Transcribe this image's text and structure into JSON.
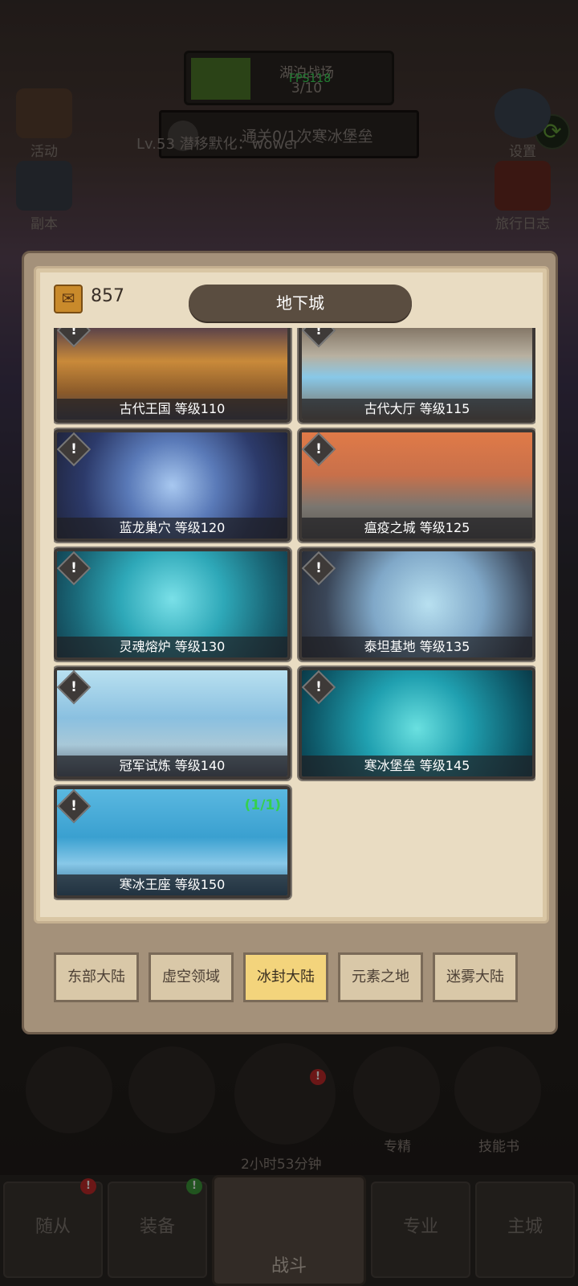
{
  "hud": {
    "stage_name": "湖泊战场",
    "stage_count": "3/10",
    "fps": "FPS118",
    "quest": "通关0/1次寒冰堡垒",
    "player": "Lv.53 潜移默化：wower"
  },
  "side_buttons": {
    "events": "活动",
    "dungeon": "副本",
    "settings": "设置",
    "travel_log": "旅行日志"
  },
  "panel": {
    "currency": "857",
    "title": "地下城",
    "dungeons": [
      {
        "label": "古代王国 等级110"
      },
      {
        "label": "古代大厅 等级115"
      },
      {
        "label": "蓝龙巢穴 等级120"
      },
      {
        "label": "瘟疫之城 等级125"
      },
      {
        "label": "灵魂熔炉 等级130"
      },
      {
        "label": "泰坦基地 等级135"
      },
      {
        "label": "冠军试炼 等级140"
      },
      {
        "label": "寒冰堡垒 等级145"
      },
      {
        "label": "寒冰王座 等级150",
        "clear": "(1/1)"
      }
    ],
    "tabs": [
      "东部大陆",
      "虚空领域",
      "冰封大陆",
      "元素之地",
      "迷雾大陆"
    ],
    "active_tab": "冰封大陆"
  },
  "bottom": {
    "timer": "2小时53分钟",
    "mastery": "专精",
    "skill_book": "技能书"
  },
  "nav": {
    "followers": "随从",
    "equipment": "装备",
    "battle": "战斗",
    "profession": "专业",
    "main_city": "主城"
  },
  "colors": {
    "accent_tab": "#f3d47c",
    "clear_green": "#35d04e",
    "fps_green": "#3de05a"
  }
}
